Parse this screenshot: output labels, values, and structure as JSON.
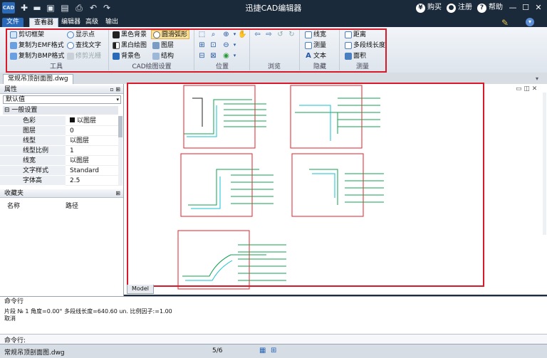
{
  "title": "迅捷CAD编辑器",
  "titlebar": {
    "logo": "CAD",
    "buy": "购买",
    "register": "注册",
    "help": "帮助"
  },
  "tabs": [
    "文件",
    "查看器",
    "编辑器",
    "高级",
    "输出"
  ],
  "ribbon": {
    "tools": {
      "label": "工具",
      "items": [
        "剪切框架",
        "复制为EMF格式",
        "复制为BMP格式",
        "显示点",
        "查找文字",
        "修剪光栅"
      ]
    },
    "cad_settings": {
      "label": "CAD绘图设置",
      "items": [
        "黑色背景",
        "黑白绘图",
        "背景色",
        "圆滑弧形",
        "图层",
        "结构"
      ]
    },
    "position": {
      "label": "位置"
    },
    "browse": {
      "label": "浏览"
    },
    "hide": {
      "label": "隐藏",
      "items": [
        "线宽",
        "测量",
        "文本"
      ]
    },
    "measure": {
      "label": "测量",
      "items": [
        "距离",
        "多段线长度",
        "面积"
      ]
    }
  },
  "document": {
    "tab": "常规吊顶剖面图.dwg"
  },
  "properties": {
    "header": "属性",
    "dropdown": "默认值",
    "section": "一般设置",
    "rows": [
      {
        "k": "色彩",
        "v": "以图层"
      },
      {
        "k": "图层",
        "v": "0"
      },
      {
        "k": "线型",
        "v": "以图层"
      },
      {
        "k": "线型比例",
        "v": "1"
      },
      {
        "k": "线宽",
        "v": "以图层"
      },
      {
        "k": "文字样式",
        "v": "Standard"
      },
      {
        "k": "字体高",
        "v": "2.5"
      }
    ]
  },
  "favorites": {
    "header": "收藏夹",
    "col_name": "名称",
    "col_path": "路径"
  },
  "canvas": {
    "model_tab": "Model"
  },
  "command": {
    "header": "命令行",
    "line1": "片段 № 1 角度=0.00° 多段线长度=640.60 un. 比例因子:=1.00",
    "line2": "取消",
    "input_label": "命令行:"
  },
  "status": {
    "file": "常规吊顶剖面图.dwg",
    "page": "5/6"
  },
  "colors": {
    "accent": "#2a68b8",
    "highlight": "#d61a2a",
    "titlebar": "#1b2a3a"
  }
}
